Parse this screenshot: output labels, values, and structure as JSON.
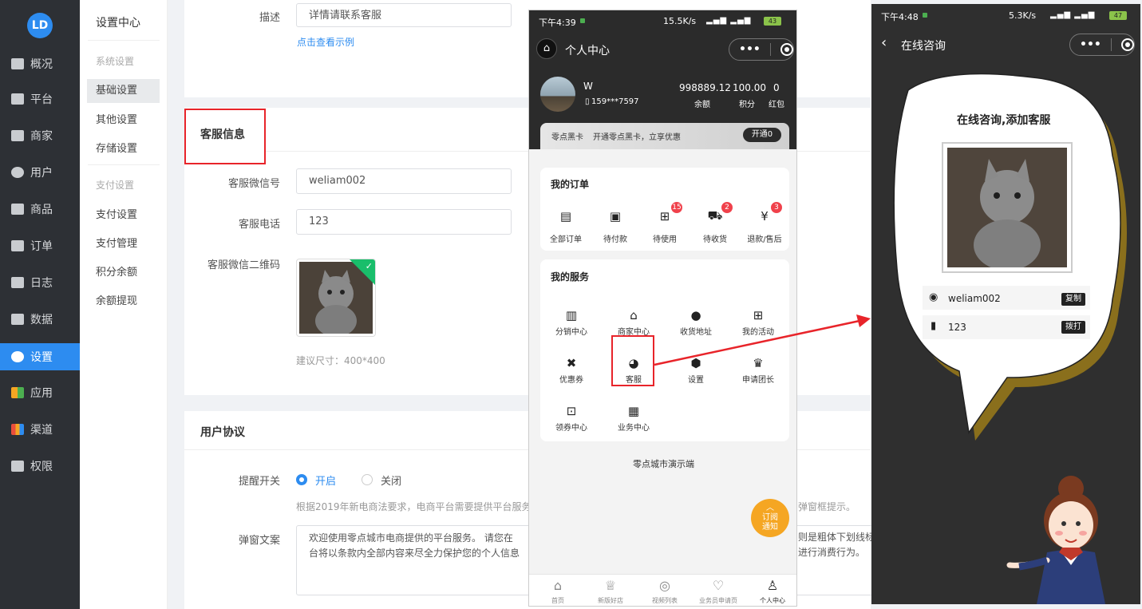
{
  "nav": {
    "logo": "LD",
    "items": [
      "概况",
      "平台",
      "商家",
      "用户",
      "商品",
      "订单",
      "日志",
      "数据",
      "设置",
      "应用",
      "渠道",
      "权限"
    ],
    "active": "设置"
  },
  "subnav": {
    "title": "设置中心",
    "group1": "系统设置",
    "group1_items": [
      "基础设置",
      "其他设置",
      "存储设置"
    ],
    "group2": "支付设置",
    "group2_items": [
      "支付设置",
      "支付管理",
      "积分余额",
      "余额提现"
    ],
    "active": "基础设置"
  },
  "form": {
    "desc_label": "描述",
    "desc_value": "详情请联系客服",
    "desc_link": "点击查看示例",
    "cs_section": "客服信息",
    "wechat_label": "客服微信号",
    "wechat_value": "weliam002",
    "phone_label": "客服电话",
    "phone_value": "123",
    "qr_label": "客服微信二维码",
    "qr_hint": "建议尺寸：400*400",
    "agreement_section": "用户协议",
    "remind_label": "提醒开关",
    "remind_on": "开启",
    "remind_off": "关闭",
    "remind_hint_a": "根据2019年新电商法要求，电商平台需要提供平台服务",
    "remind_hint_b": "弹窗框提示。",
    "popup_label": "弹窗文案",
    "popup_line1a": "欢迎使用零点城市电商提供的平台服务。 请您在",
    "popup_line1b": "则是粗体下划线标",
    "popup_line2a": "台将以条款内全部内容来尽全力保护您的个人信息",
    "popup_line2b": "进行消费行为。"
  },
  "phone1": {
    "status_time": "下午4:39",
    "status_right": "15.5K/s",
    "battery": "43",
    "title": "个人中心",
    "user_name": "W",
    "user_phone": "159***7597",
    "stats": [
      {
        "value": "998889.12",
        "label": "余额"
      },
      {
        "value": "100.00",
        "label": "积分"
      },
      {
        "value": "0",
        "label": "红包"
      }
    ],
    "vip_name": "零点黑卡",
    "vip_text": "开通零点黑卡，立享优惠",
    "vip_button": "开通0",
    "orders_title": "我的订单",
    "orders": [
      {
        "label": "全部订单",
        "icon": "doc-icon",
        "badge": ""
      },
      {
        "label": "待付款",
        "icon": "wallet-icon",
        "badge": ""
      },
      {
        "label": "待使用",
        "icon": "gift-icon",
        "badge": "15"
      },
      {
        "label": "待收货",
        "icon": "truck-icon",
        "badge": "2"
      },
      {
        "label": "退款/售后",
        "icon": "yen-icon",
        "badge": "3"
      }
    ],
    "services_title": "我的服务",
    "services": [
      {
        "label": "分销中心",
        "icon": "building-icon"
      },
      {
        "label": "商家中心",
        "icon": "shop-icon"
      },
      {
        "label": "收货地址",
        "icon": "location-icon"
      },
      {
        "label": "我的活动",
        "icon": "gift-icon"
      },
      {
        "label": "优惠券",
        "icon": "coupon-icon"
      },
      {
        "label": "客服",
        "icon": "chat-icon"
      },
      {
        "label": "设置",
        "icon": "settings-icon"
      },
      {
        "label": "申请团长",
        "icon": "crown-icon"
      },
      {
        "label": "领券中心",
        "icon": "bag-icon"
      },
      {
        "label": "业务中心",
        "icon": "briefcase-icon"
      }
    ],
    "footer_text": "零点城市演示端",
    "subscribe_line1": "订阅",
    "subscribe_line2": "通知",
    "tabbar": [
      "首页",
      "新版好店",
      "视频列表",
      "业务员申请页",
      "个人中心"
    ],
    "tab_active": "个人中心"
  },
  "phone2": {
    "status_time": "下午4:48",
    "status_right": "5.3K/s",
    "battery": "47",
    "title": "在线咨询",
    "bubble_title": "在线咨询,添加客服",
    "wechat": "weliam002",
    "copy_button": "复制",
    "phone": "123",
    "call_button": "拨打"
  },
  "colors": {
    "accent": "#2d8cf0",
    "highlight": "#e8242a",
    "nav_bg": "#2d3035",
    "subscribe": "#f5a623"
  }
}
